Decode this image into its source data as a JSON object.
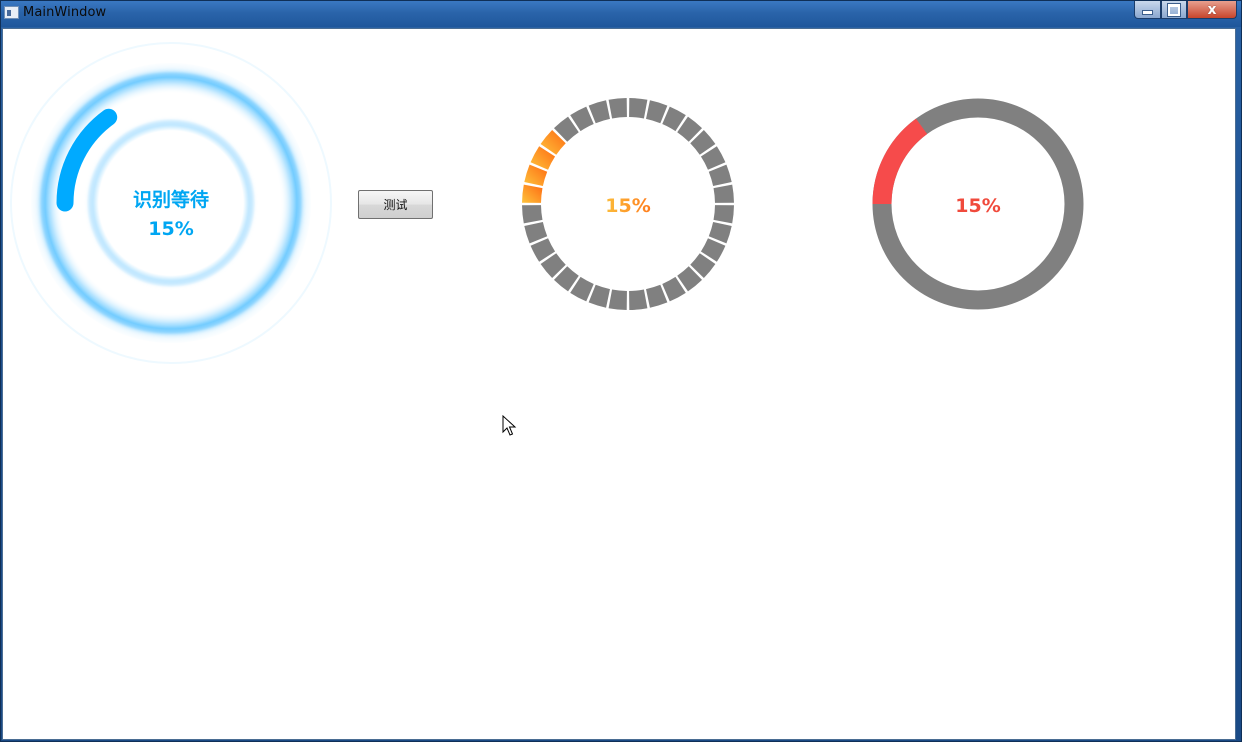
{
  "window": {
    "title": "MainWindow",
    "icons": {
      "app": "window-icon",
      "minimize": "minimize-icon",
      "maximize": "maximize-icon",
      "close": "close-icon"
    },
    "close_glyph": "x"
  },
  "progress": {
    "value_percent": 15,
    "label_text": "15%"
  },
  "ring1": {
    "caption": "识别等待",
    "percent_text": "15%",
    "color": "#00aaff",
    "style": "glow-arc"
  },
  "test_button": {
    "label": "测试"
  },
  "ring2": {
    "percent_text": "15%",
    "segment_count": 32,
    "track_color": "#808080",
    "fill_gradient": [
      "#fdc33c",
      "#ff7a1a"
    ],
    "text_gradient": [
      "#fcbc3a",
      "#ff8a1f"
    ],
    "style": "segmented-ring"
  },
  "ring3": {
    "percent_text": "15%",
    "track_color": "#808080",
    "fill_color": "#f64b4b",
    "style": "solid-ring"
  },
  "colors": {
    "accent_blue": "#00aaff",
    "accent_orange": "#ff8a1f",
    "accent_red": "#f64b4b",
    "track_gray": "#808080"
  }
}
